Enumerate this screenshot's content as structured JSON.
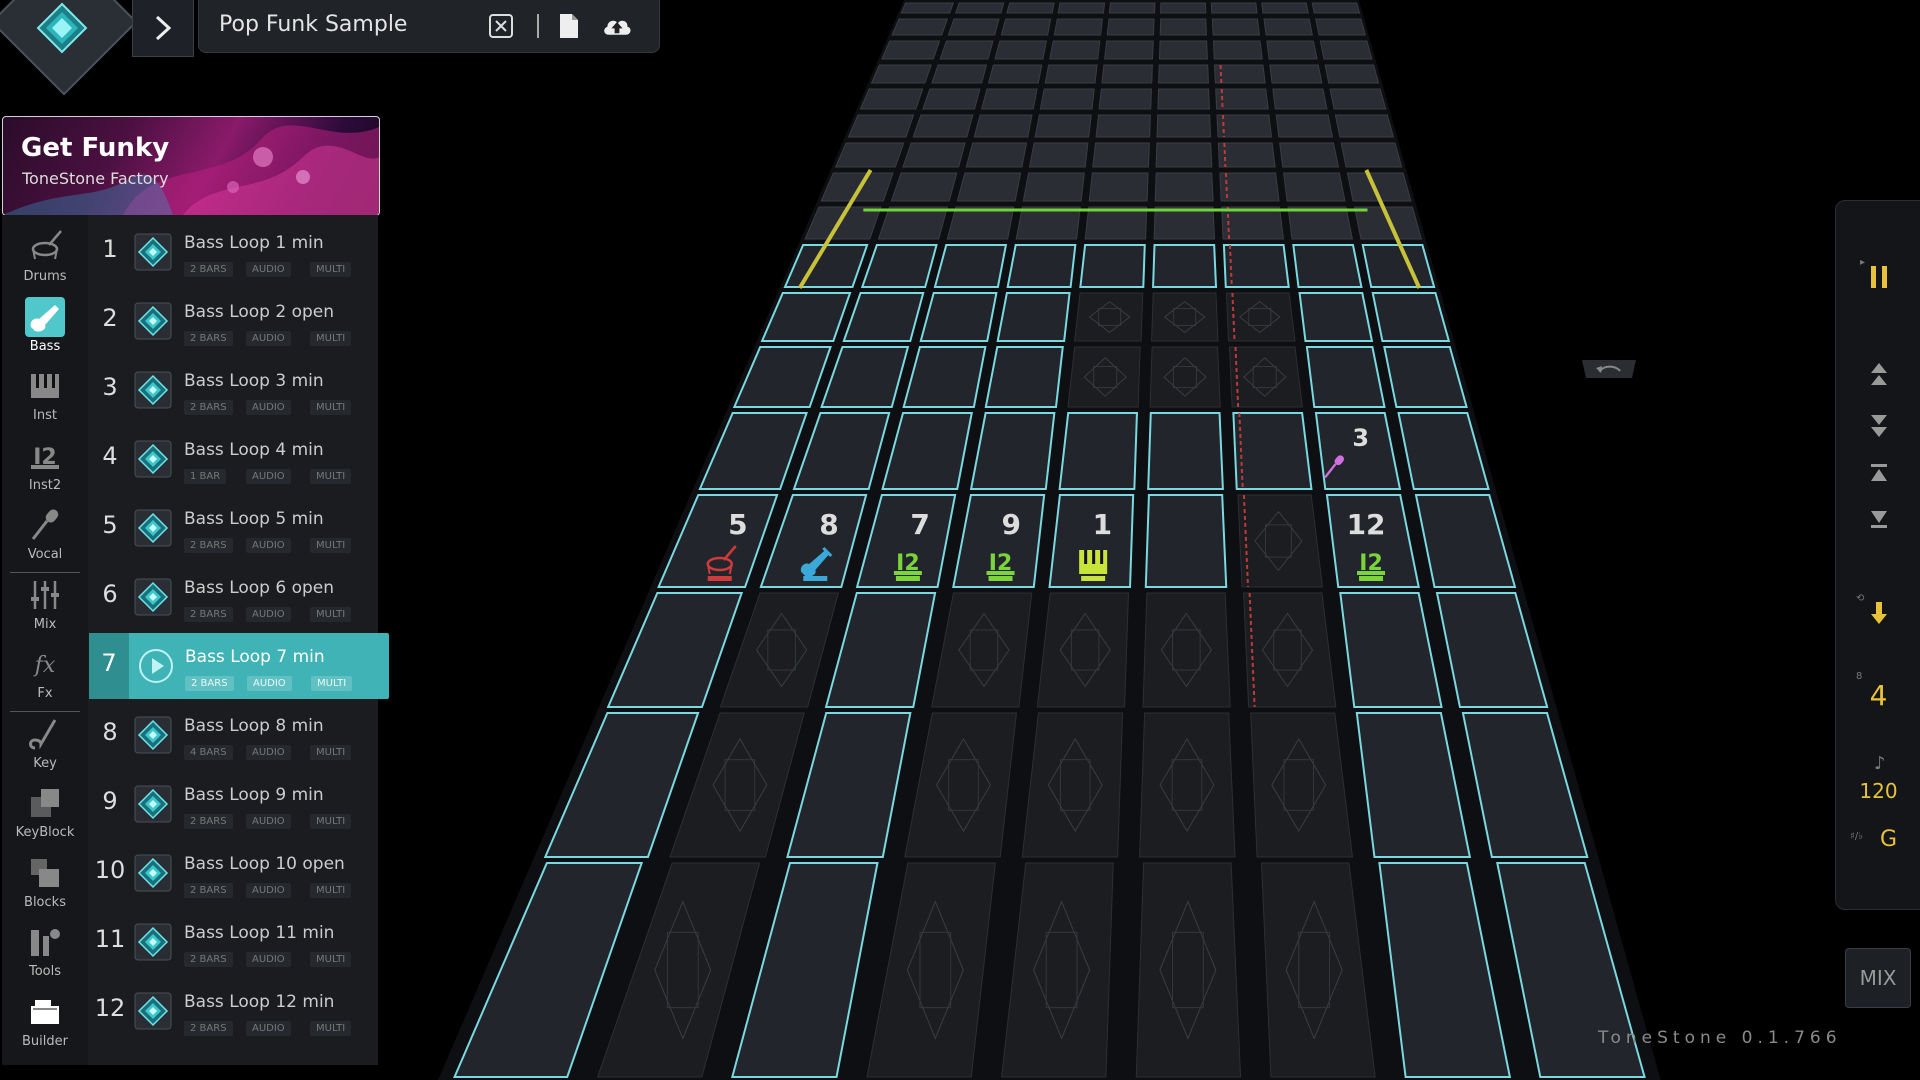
{
  "project": {
    "name": "Pop Funk Sample",
    "icons": [
      "close-file-icon",
      "new-file-icon",
      "cloud-upload-icon"
    ]
  },
  "kit": {
    "title": "Get Funky",
    "subtitle": "ToneStone Factory"
  },
  "categories": [
    {
      "label": "Drums",
      "icon": "drum-icon"
    },
    {
      "label": "Bass",
      "icon": "bass-guitar-icon",
      "active": true
    },
    {
      "label": "Inst",
      "icon": "keyboard-icon"
    },
    {
      "label": "Inst2",
      "icon": "keyboard-2-icon"
    },
    {
      "label": "Vocal",
      "icon": "microphone-icon"
    },
    {
      "label": "Mix",
      "icon": "mixer-icon"
    },
    {
      "label": "Fx",
      "icon": "fx-icon"
    },
    {
      "label": "Key",
      "icon": "key-icon"
    },
    {
      "label": "KeyBlock",
      "icon": "keyblock-icon"
    },
    {
      "label": "Blocks",
      "icon": "blocks-icon"
    },
    {
      "label": "Tools",
      "icon": "tools-icon"
    },
    {
      "label": "Builder",
      "icon": "builder-icon"
    }
  ],
  "loops": [
    {
      "num": "1",
      "name": "Bass Loop 1 min",
      "bars": "2 BARS",
      "type": "AUDIO",
      "mode": "MULTI"
    },
    {
      "num": "2",
      "name": "Bass Loop 2 open",
      "bars": "2 BARS",
      "type": "AUDIO",
      "mode": "MULTI"
    },
    {
      "num": "3",
      "name": "Bass Loop 3 min",
      "bars": "2 BARS",
      "type": "AUDIO",
      "mode": "MULTI"
    },
    {
      "num": "4",
      "name": "Bass Loop 4 min",
      "bars": "1 BAR",
      "type": "AUDIO",
      "mode": "MULTI"
    },
    {
      "num": "5",
      "name": "Bass Loop 5 min",
      "bars": "2 BARS",
      "type": "AUDIO",
      "mode": "MULTI"
    },
    {
      "num": "6",
      "name": "Bass Loop 6 open",
      "bars": "2 BARS",
      "type": "AUDIO",
      "mode": "MULTI"
    },
    {
      "num": "7",
      "name": "Bass Loop 7 min",
      "bars": "2 BARS",
      "type": "AUDIO",
      "mode": "MULTI",
      "active": true
    },
    {
      "num": "8",
      "name": "Bass Loop 8 min",
      "bars": "4 BARS",
      "type": "AUDIO",
      "mode": "MULTI"
    },
    {
      "num": "9",
      "name": "Bass Loop 9 min",
      "bars": "2 BARS",
      "type": "AUDIO",
      "mode": "MULTI"
    },
    {
      "num": "10",
      "name": "Bass Loop 10 open",
      "bars": "2 BARS",
      "type": "AUDIO",
      "mode": "MULTI"
    },
    {
      "num": "11",
      "name": "Bass Loop 11 min",
      "bars": "2 BARS",
      "type": "AUDIO",
      "mode": "MULTI"
    },
    {
      "num": "12",
      "name": "Bass Loop 12 min",
      "bars": "2 BARS",
      "type": "AUDIO",
      "mode": "MULTI"
    }
  ],
  "grid": {
    "featured_row": [
      {
        "num": "5",
        "icon": "drum-icon",
        "color": "#d03a3a"
      },
      {
        "num": "8",
        "icon": "bass-guitar-icon",
        "color": "#3aa8d8"
      },
      {
        "num": "7",
        "icon": "keyboard-2-icon",
        "color": "#7bd43a"
      },
      {
        "num": "9",
        "icon": "keyboard-2-icon",
        "color": "#7bd43a"
      },
      {
        "num": "1",
        "icon": "keyboard-icon",
        "color": "#c8e43a"
      },
      {
        "num": "",
        "icon": "",
        "color": ""
      },
      {
        "num": "12",
        "icon": "keyboard-2-icon",
        "color": "#7bd43a"
      }
    ],
    "vocal_tile": {
      "num": "3",
      "icon": "microphone-icon"
    }
  },
  "transport": {
    "pause_icon": "pause-icon",
    "bars": "4",
    "bars_small": "8",
    "tempo": "120",
    "key": "G",
    "key_prefix": "♯/♭",
    "accent": "#e8c23a"
  },
  "mix_label": "MIX",
  "version": "ToneStone 0.1.766"
}
